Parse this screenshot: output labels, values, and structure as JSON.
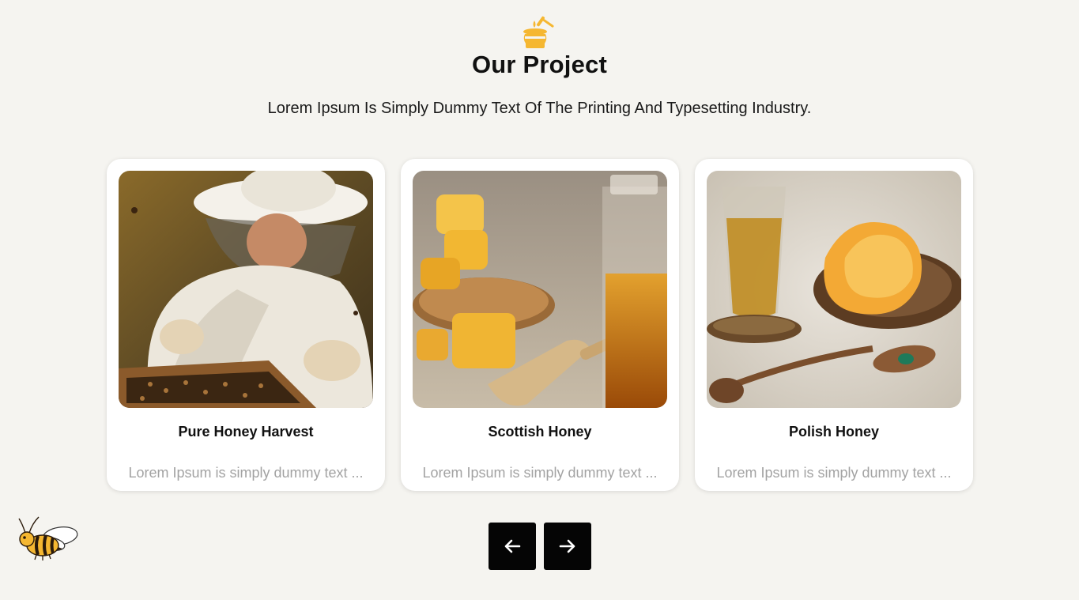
{
  "section": {
    "icon": "honey-pot-icon",
    "title": "Our Project",
    "subtitle": "Lorem Ipsum Is Simply Dummy Text Of The Printing And Typesetting Industry."
  },
  "cards": [
    {
      "title": "Pure Honey Harvest",
      "description": "Lorem Ipsum is simply dummy text ...",
      "image": "beekeeper-with-honeycomb-frame"
    },
    {
      "title": "Scottish Honey",
      "description": "Lorem Ipsum is simply dummy text ...",
      "image": "honeycomb-and-honey-jar"
    },
    {
      "title": "Polish Honey",
      "description": "Lorem Ipsum is simply dummy text ...",
      "image": "tea-glass-with-honeycomb"
    }
  ],
  "navigation": {
    "prev_icon": "arrow-left-icon",
    "next_icon": "arrow-right-icon"
  },
  "decoration": {
    "icon": "bee-icon"
  },
  "colors": {
    "background": "#f5f4f0",
    "accent": "#f5b731",
    "button": "#050505",
    "muted_text": "#a3a3a3"
  }
}
